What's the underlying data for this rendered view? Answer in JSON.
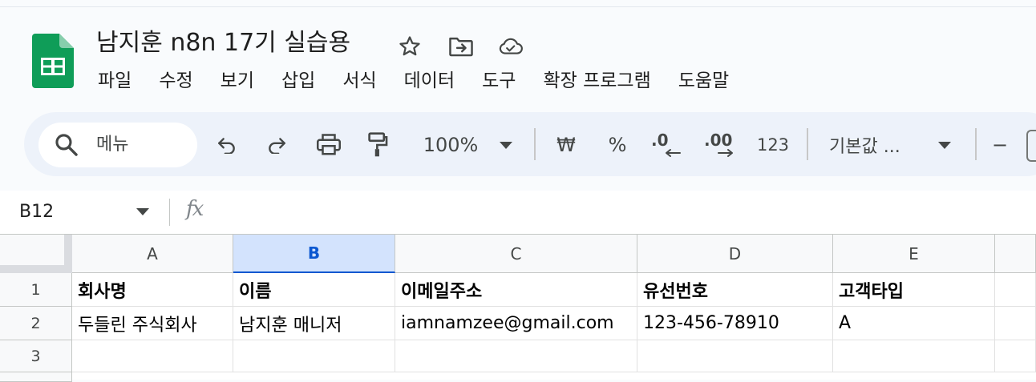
{
  "document": {
    "title": "남지훈 n8n 17기 실습용"
  },
  "menu": [
    "파일",
    "수정",
    "보기",
    "삽입",
    "서식",
    "데이터",
    "도구",
    "확장 프로그램",
    "도움말"
  ],
  "toolbar": {
    "search_label": "메뉴",
    "zoom": "100%",
    "currency": "₩",
    "percent": "%",
    "decrease_decimal": ".0",
    "increase_decimal": ".00",
    "number_format": "123",
    "font": "기본값 ...",
    "minus": "−"
  },
  "formula_bar": {
    "cell_ref": "B12",
    "fx": "fx"
  },
  "columns": [
    "A",
    "B",
    "C",
    "D",
    "E"
  ],
  "rows": [
    "1",
    "2",
    "3"
  ],
  "cells": {
    "r1": [
      "회사명",
      "이름",
      "이메일주소",
      "유선번호",
      "고객타입"
    ],
    "r2": [
      "두들린 주식회사",
      "남지훈 매니저",
      "iamnamzee@gmail.com",
      "123-456-78910",
      "A"
    ],
    "r3": [
      "",
      "",
      "",
      "",
      ""
    ]
  },
  "colors": {
    "accent": "#0b57d0",
    "sheets_green": "#0f9d58",
    "toolbar_bg": "#edf2fa"
  }
}
